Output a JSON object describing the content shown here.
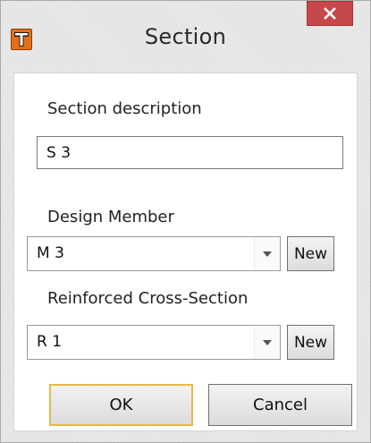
{
  "window": {
    "title": "Section"
  },
  "section_description": {
    "label": "Section description",
    "value": "S 3"
  },
  "design_member": {
    "label": "Design Member",
    "selected": "M 3",
    "new_label": "New"
  },
  "reinforced_cross_section": {
    "label": "Reinforced Cross-Section",
    "selected": "R 1",
    "new_label": "New"
  },
  "buttons": {
    "ok": "OK",
    "cancel": "Cancel"
  },
  "colors": {
    "app_icon": "#e46f18",
    "close_button": "#c74848",
    "default_button_border": "#e6b84a"
  },
  "icons": {
    "app": "app-t-logo-icon",
    "close": "close-icon",
    "dropdown": "chevron-down-icon"
  }
}
